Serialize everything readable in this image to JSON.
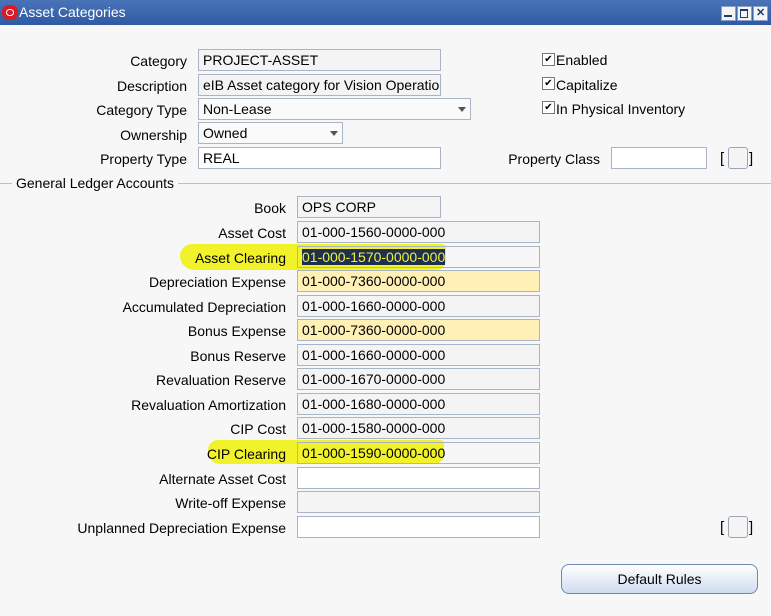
{
  "window": {
    "title": "Asset Categories"
  },
  "header": {
    "category": {
      "label": "Category",
      "value": "PROJECT-ASSET"
    },
    "description": {
      "label": "Description",
      "value": "eIB Asset category for Vision Operations"
    },
    "category_type": {
      "label": "Category Type",
      "value": "Non-Lease"
    },
    "ownership": {
      "label": "Ownership",
      "value": "Owned"
    },
    "property_type": {
      "label": "Property Type",
      "value": "REAL"
    },
    "property_class": {
      "label": "Property Class",
      "value": ""
    },
    "checkboxes": [
      {
        "label": "Enabled",
        "checked": true
      },
      {
        "label": "Capitalize",
        "checked": true
      },
      {
        "label": "In Physical Inventory",
        "checked": true
      }
    ]
  },
  "gl": {
    "section_title": "General Ledger Accounts",
    "book": {
      "label": "Book",
      "value": "OPS CORP"
    },
    "accounts": [
      {
        "label": "Asset Cost",
        "value": "01-000-1560-0000-000",
        "style": "grey"
      },
      {
        "label": "Asset Clearing",
        "value": "01-000-1570-0000-000",
        "style": "grey"
      },
      {
        "label": "Depreciation Expense",
        "value": "01-000-7360-0000-000",
        "style": "yellow"
      },
      {
        "label": "Accumulated Depreciation",
        "value": "01-000-1660-0000-000",
        "style": "grey"
      },
      {
        "label": "Bonus Expense",
        "value": "01-000-7360-0000-000",
        "style": "yellow"
      },
      {
        "label": "Bonus Reserve",
        "value": "01-000-1660-0000-000",
        "style": "grey"
      },
      {
        "label": "Revaluation Reserve",
        "value": "01-000-1670-0000-000",
        "style": "grey"
      },
      {
        "label": "Revaluation Amortization",
        "value": "01-000-1680-0000-000",
        "style": "grey"
      },
      {
        "label": "CIP Cost",
        "value": "01-000-1580-0000-000",
        "style": "grey"
      },
      {
        "label": "CIP Clearing",
        "value": "01-000-1590-0000-000",
        "style": "grey"
      },
      {
        "label": "Alternate Asset Cost",
        "value": "",
        "style": "white"
      },
      {
        "label": "Write-off Expense",
        "value": "",
        "style": "grey"
      },
      {
        "label": "Unplanned Depreciation Expense",
        "value": "",
        "style": "white"
      }
    ]
  },
  "buttons": {
    "default_rules": "Default Rules"
  },
  "brackets": {
    "open": "[",
    "close": "]"
  },
  "colors": {
    "titlebar": "#2f5aa3",
    "highlight": "#f2f22a",
    "required_field": "#fff0b6"
  }
}
